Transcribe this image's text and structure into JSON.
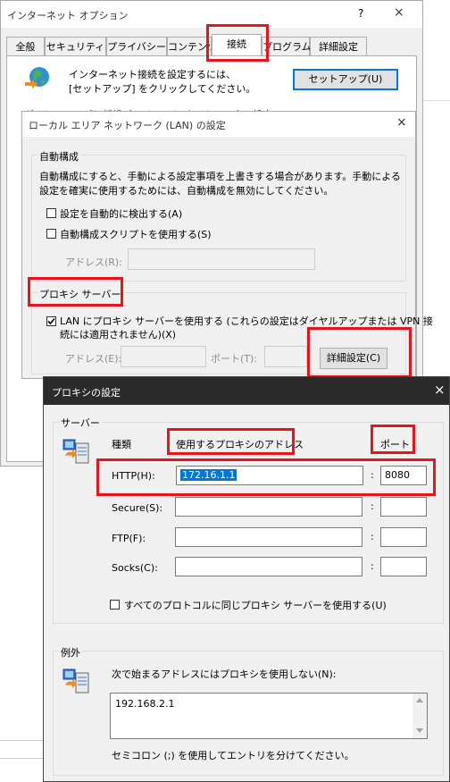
{
  "inet": {
    "title": "インターネット オプション",
    "help": "?",
    "close": "×",
    "tabs": [
      "全般",
      "セキュリティ",
      "プライバシー",
      "コンテンツ",
      "接続",
      "プログラム",
      "詳細設定"
    ],
    "setup_text_1": "インターネット接続を設定するには、",
    "setup_text_2": "[セットアップ] をクリックしてください。",
    "setup_button": "セットアップ(U)"
  },
  "lan": {
    "title": "ローカル エリア ネットワーク (LAN) の設定",
    "close": "×",
    "auto_group": "自動構成",
    "auto_desc_1": "自動構成にすると、手動による設定事項を上書きする場合があります。手動による",
    "auto_desc_2": "設定を確実に使用するためには、自動構成を無効にしてください。",
    "auto_detect": "設定を自動的に検出する(A)",
    "auto_script": "自動構成スクリプトを使用する(S)",
    "address_label": "アドレス(R):",
    "proxy_group": "プロキシ サーバー",
    "use_proxy_1": "LAN にプロキシ サーバーを使用する (これらの設定はダイヤルアップまたは VPN 接",
    "use_proxy_2": "続には適用されません)(X)",
    "proxy_address_label": "アドレス(E):",
    "port_label": "ポート(T):",
    "advanced_button": "詳細設定(C)"
  },
  "proxy": {
    "title": "プロキシの設定",
    "close": "×",
    "servers_group": "サーバー",
    "type_header": "種類",
    "address_header": "使用するプロキシのアドレス",
    "port_header": "ポート",
    "rows": [
      {
        "label": "HTTP(H):",
        "address": "172.16.1.1",
        "port": "8080"
      },
      {
        "label": "Secure(S):",
        "address": "",
        "port": ""
      },
      {
        "label": "FTP(F):",
        "address": "",
        "port": ""
      },
      {
        "label": "Socks(C):",
        "address": "",
        "port": ""
      }
    ],
    "colon": ":",
    "same_proxy": "すべてのプロトコルに同じプロキシ サーバーを使用する(U)",
    "exceptions_group": "例外",
    "exceptions_label": "次で始まるアドレスにはプロキシを使用しない(N):",
    "exceptions_value": "192.168.2.1",
    "exceptions_note": "セミコロン (;) を使用してエントリを分けてください。"
  },
  "colors": {
    "highlight": "#e8141c",
    "selection": "#0078d7",
    "dark_titlebar": "#2b2b2b"
  }
}
